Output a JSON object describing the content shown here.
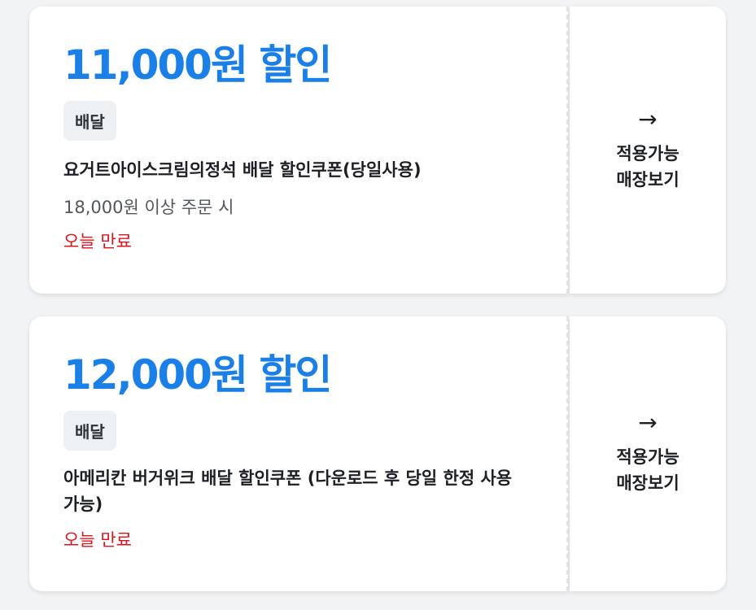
{
  "coupons": [
    {
      "amount": "11,000원 할인",
      "badge": "배달",
      "title": "요거트아이스크림의정석 배달 할인쿠폰(당일사용)",
      "condition": "18,000원 이상 주문 시",
      "expiry": "오늘 만료",
      "action_icon": "arrow-right-icon",
      "action_line1": "적용가능",
      "action_line2": "매장보기"
    },
    {
      "amount": "12,000원 할인",
      "badge": "배달",
      "title": "아메리칸 버거위크 배달 할인쿠폰 (다운로드 후 당일 한정 사용가능)",
      "expiry": "오늘 만료",
      "action_icon": "arrow-right-icon",
      "action_line1": "적용가능",
      "action_line2": "매장보기"
    }
  ],
  "colors": {
    "amount": "#1a7fe6",
    "expiry": "#e0121c",
    "badge_bg": "#eef1f4"
  }
}
